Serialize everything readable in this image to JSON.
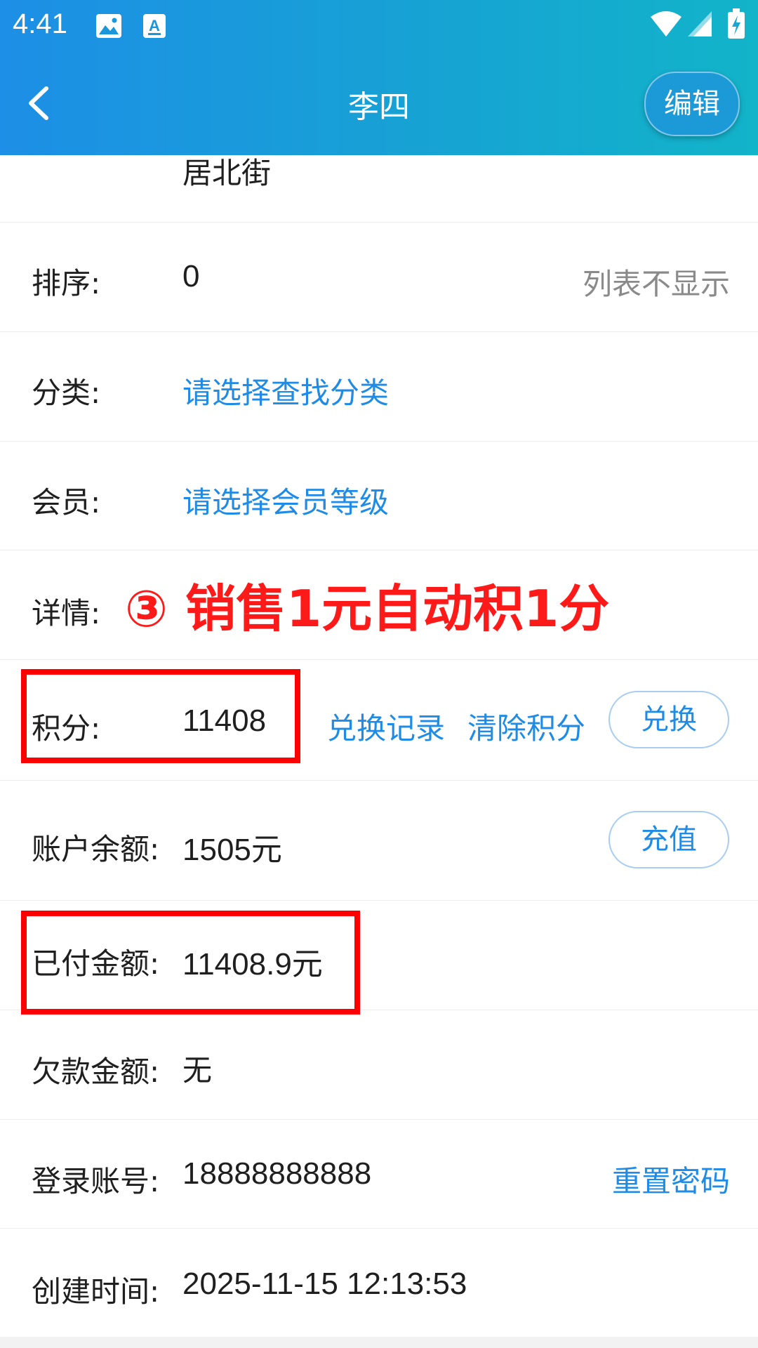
{
  "status_bar": {
    "time": "4:41",
    "icons": [
      "image-icon",
      "text-a-icon",
      "wifi-icon",
      "signal-icon",
      "battery-charging-icon"
    ]
  },
  "header": {
    "title": "李四",
    "back_icon": "chevron-left-icon",
    "edit_label": "编辑"
  },
  "colors": {
    "header_gradient_start": "#1d8fe6",
    "header_gradient_end": "#12b4c9",
    "link": "#1e8be6",
    "annotation": "#ff1a1a",
    "highlight_box": "#ff0000"
  },
  "address": {
    "value_tail": "居北街"
  },
  "rows": {
    "sort": {
      "label": "排序:",
      "value": "0",
      "hint": "列表不显示"
    },
    "category": {
      "label": "分类:",
      "value": "请选择查找分类"
    },
    "member": {
      "label": "会员:",
      "value": "请选择会员等级"
    },
    "details": {
      "label": "详情:",
      "annotation": "③ 销售1元自动积1分"
    },
    "points": {
      "label": "积分:",
      "value": "11408",
      "exchange_record": "兑换记录",
      "clear_points": "清除积分",
      "exchange_button": "兑换"
    },
    "balance": {
      "label": "账户余额:",
      "value": "1505元",
      "recharge_button": "充值"
    },
    "paid": {
      "label": "已付金额:",
      "value": "11408.9元"
    },
    "debt": {
      "label": "欠款金额:",
      "value": "无"
    },
    "login": {
      "label": "登录账号:",
      "value": "18888888888",
      "reset_password": "重置密码"
    },
    "created": {
      "label": "创建时间:",
      "value": "2025-11-15 12:13:53"
    }
  }
}
